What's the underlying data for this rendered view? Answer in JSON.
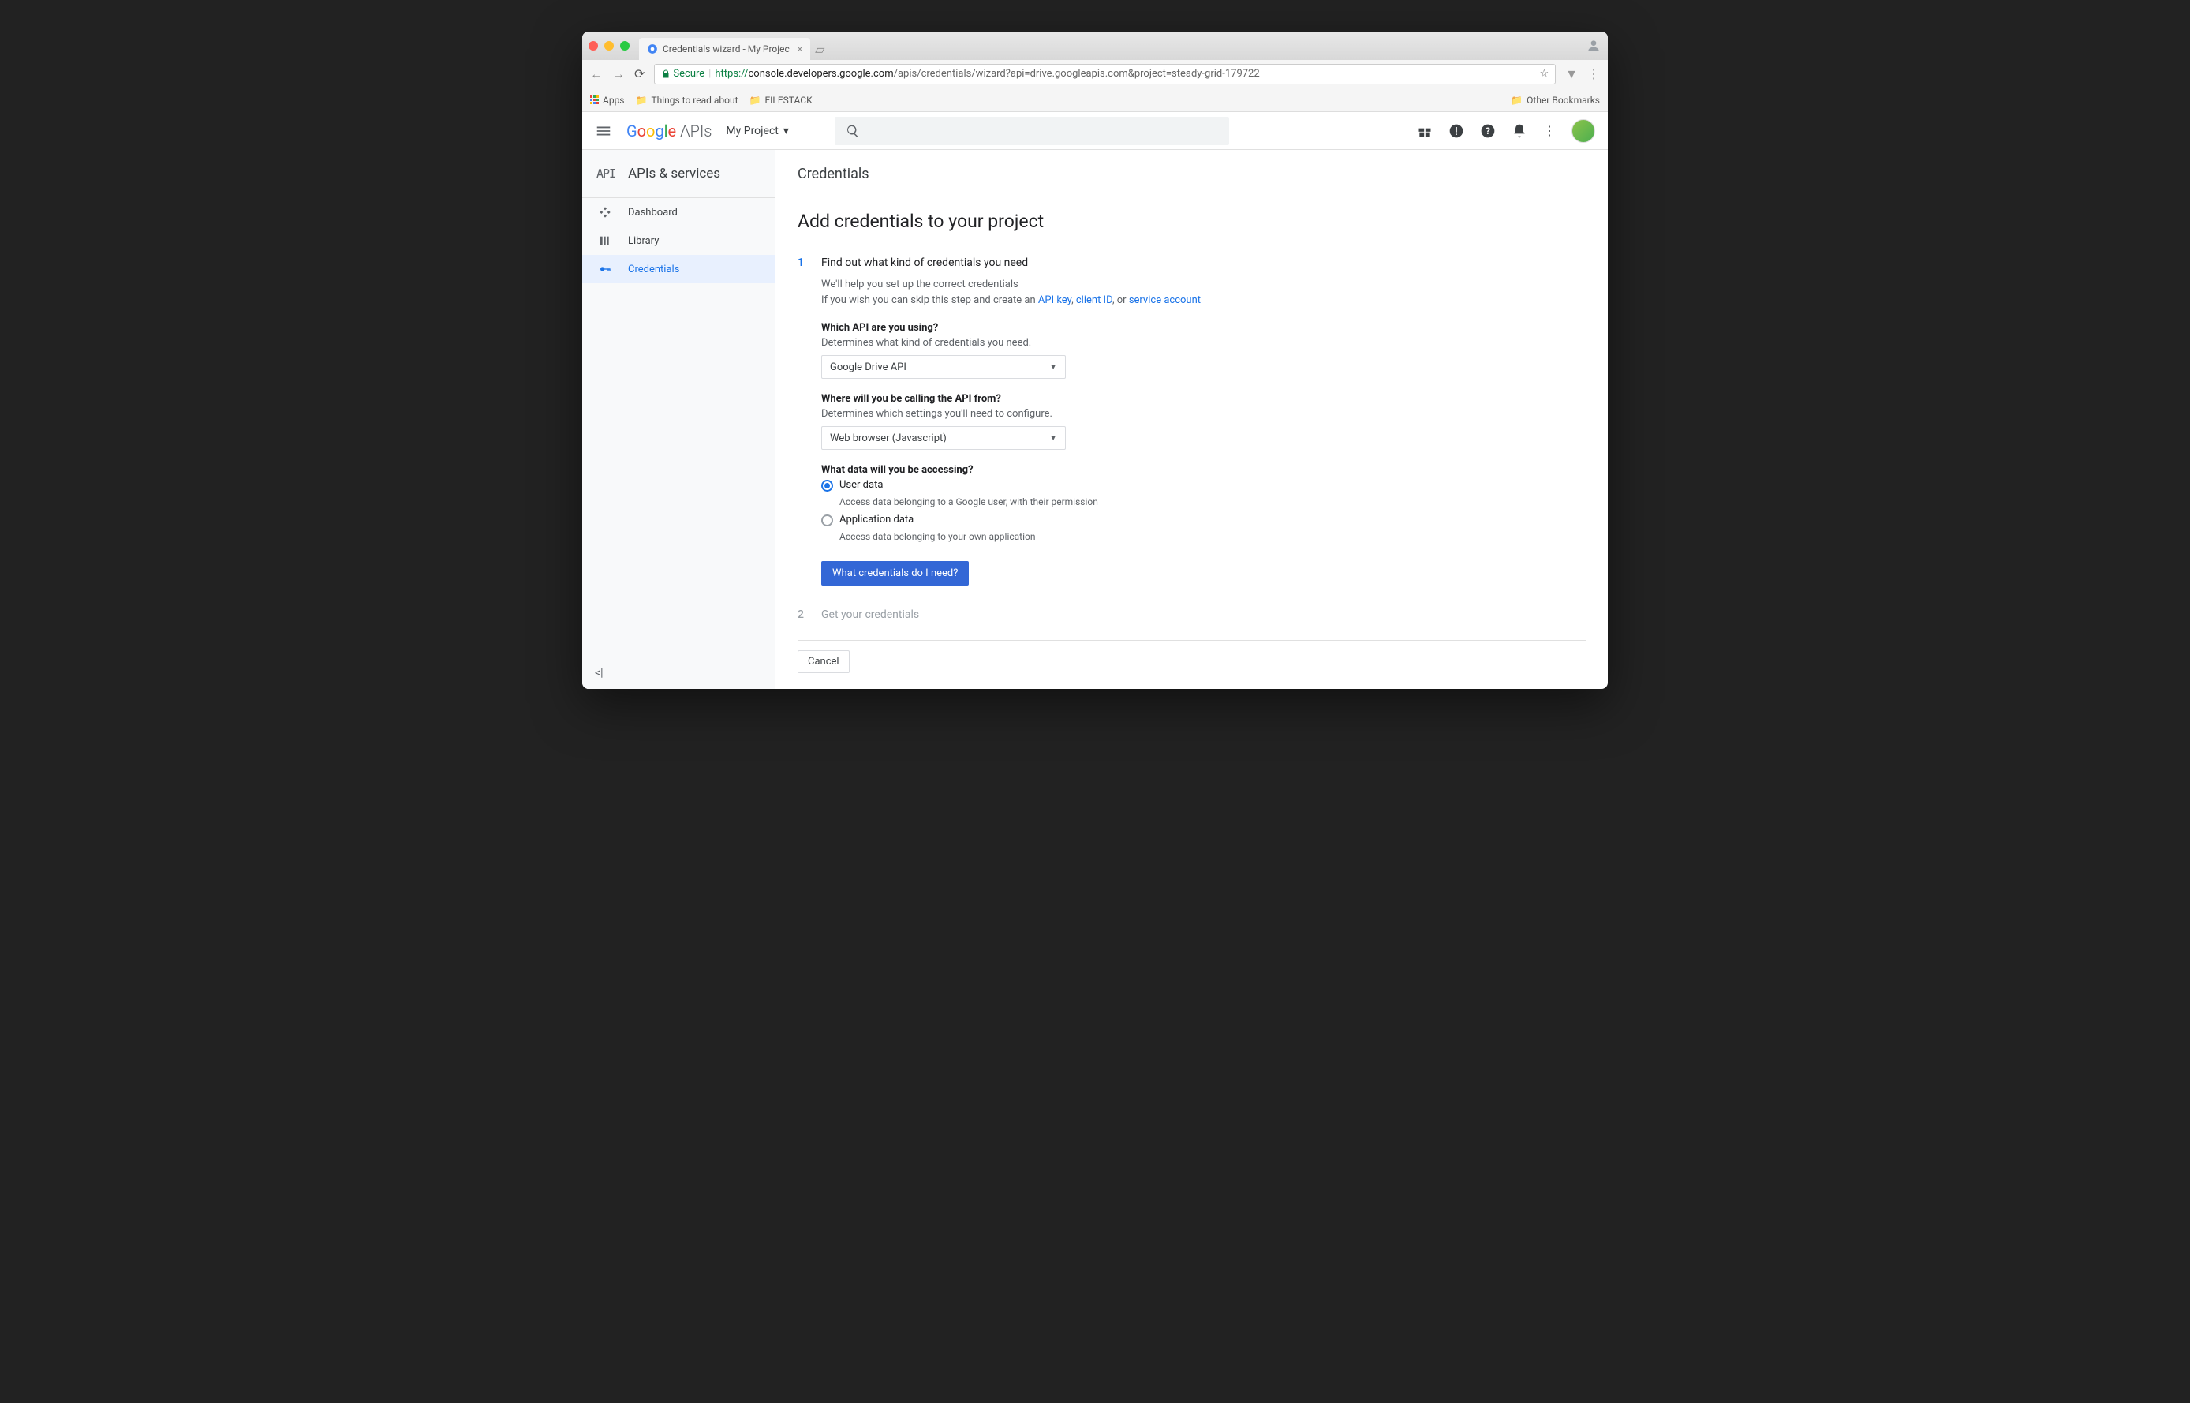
{
  "browser": {
    "tab_title": "Credentials wizard - My Projec",
    "secure_label": "Secure",
    "url_prefix": "https://",
    "url_domain": "console.developers.google.com",
    "url_path": "/apis/credentials/wizard?api=drive.googleapis.com&project=steady-grid-179722",
    "bookmarks": {
      "apps": "Apps",
      "items": [
        "Things to read about",
        "FILESTACK"
      ],
      "other": "Other Bookmarks"
    }
  },
  "header": {
    "logo_text": "Google",
    "logo_suffix": "APIs",
    "project": "My Project"
  },
  "sidebar": {
    "title": "APIs & services",
    "items": [
      {
        "label": "Dashboard"
      },
      {
        "label": "Library"
      },
      {
        "label": "Credentials"
      }
    ]
  },
  "main": {
    "page_title": "Credentials",
    "section_title": "Add credentials to your project",
    "step1": {
      "num": "1",
      "title": "Find out what kind of credentials you need",
      "help1": "We'll help you set up the correct credentials",
      "help2_pre": "If you wish you can skip this step and create an ",
      "link_api_key": "API key",
      "sep1": ", ",
      "link_client_id": "client ID",
      "sep2": ", or ",
      "link_service_account": "service account",
      "q1_label": "Which API are you using?",
      "q1_desc": "Determines what kind of credentials you need.",
      "q1_value": "Google Drive API",
      "q2_label": "Where will you be calling the API from?",
      "q2_desc": "Determines which settings you'll need to configure.",
      "q2_value": "Web browser (Javascript)",
      "q3_label": "What data will you be accessing?",
      "opt1_label": "User data",
      "opt1_desc": "Access data belonging to a Google user, with their permission",
      "opt2_label": "Application data",
      "opt2_desc": "Access data belonging to your own application",
      "button": "What credentials do I need?"
    },
    "step2": {
      "num": "2",
      "title": "Get your credentials"
    },
    "cancel": "Cancel"
  }
}
